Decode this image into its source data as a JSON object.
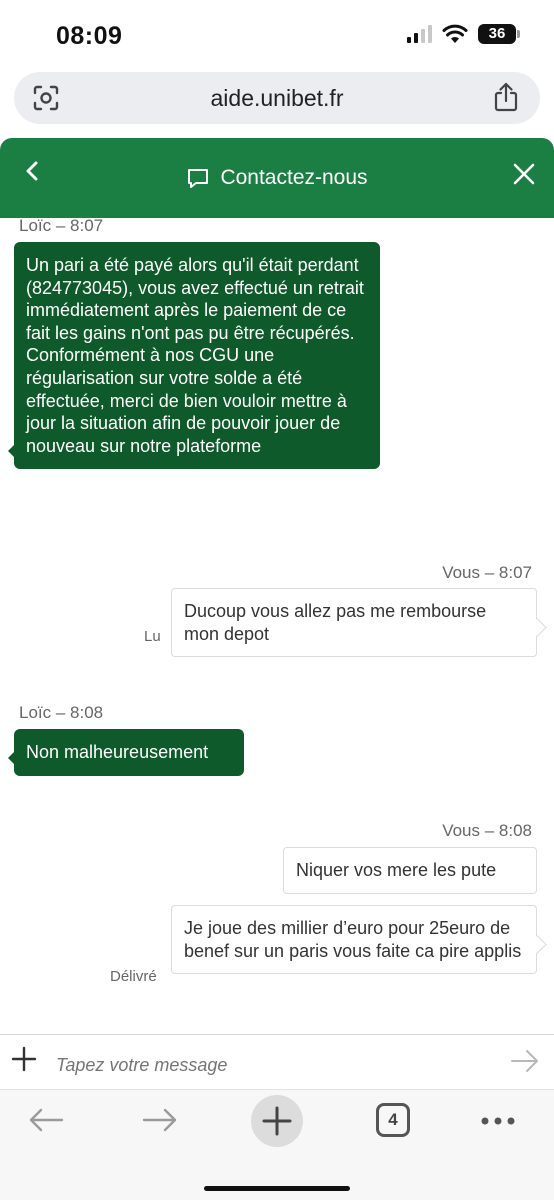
{
  "status": {
    "time": "08:09",
    "battery": "36"
  },
  "browser": {
    "url": "aide.unibet.fr"
  },
  "header": {
    "title": "Contactez-nous"
  },
  "messages": [
    {
      "sender": "Loïc – 8:07",
      "text": "Un pari a été payé alors qu'il était perdant (824773045), vous avez effectué un retrait immédiatement après le paiement de ce fait les gains n'ont pas pu être récupérés. Conformément à nos CGU une régularisation sur votre solde a été effectuée, merci de bien vouloir mettre à jour la situation afin de pouvoir jouer de nouveau sur notre plateforme"
    },
    {
      "sender": "Vous – 8:07",
      "text": "Ducoup vous allez pas me rembourse mon depot",
      "receipt": "Lu"
    },
    {
      "sender": "Loïc – 8:08",
      "text": "Non malheureusement"
    },
    {
      "sender": "Vous – 8:08",
      "text": "Niquer vos mere les pute"
    },
    {
      "text": "Je joue des millier d’euro pour 25euro de benef sur un paris vous faite ca pire applis",
      "receipt": "Délivré"
    }
  ],
  "composer": {
    "placeholder": "Tapez votre message"
  },
  "toolbar": {
    "tabs_count": "4"
  }
}
